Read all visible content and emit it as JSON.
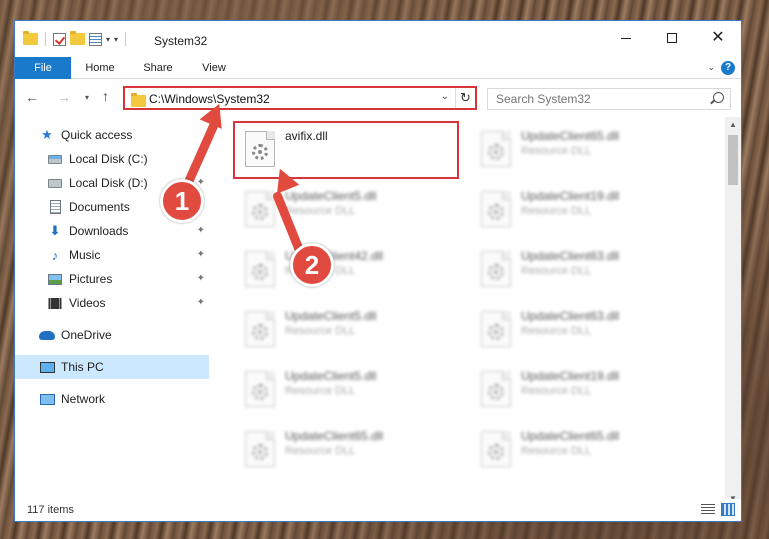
{
  "window": {
    "title": "System32",
    "tabs": [
      "File",
      "Home",
      "Share",
      "View"
    ]
  },
  "address": {
    "path": "C:\\Windows\\System32",
    "search_placeholder": "Search System32"
  },
  "sidebar": {
    "items": [
      {
        "label": "Quick access",
        "icon": "star-icon",
        "pinned": false
      },
      {
        "label": "Local Disk (C:)",
        "icon": "local-disk-c-icon",
        "pinned": false
      },
      {
        "label": "Local Disk (D:)",
        "icon": "local-disk-icon",
        "pinned": true
      },
      {
        "label": "Documents",
        "icon": "documents-icon",
        "pinned": true
      },
      {
        "label": "Downloads",
        "icon": "downloads-icon",
        "pinned": true
      },
      {
        "label": "Music",
        "icon": "music-icon",
        "pinned": true
      },
      {
        "label": "Pictures",
        "icon": "pictures-icon",
        "pinned": true
      },
      {
        "label": "Videos",
        "icon": "videos-icon",
        "pinned": true
      },
      {
        "label": "OneDrive",
        "icon": "onedrive-icon",
        "pinned": false
      },
      {
        "label": "This PC",
        "icon": "this-pc-icon",
        "pinned": false,
        "selected": true
      },
      {
        "label": "Network",
        "icon": "network-icon",
        "pinned": false
      }
    ]
  },
  "files": [
    {
      "name": "avifix.dll",
      "type": "",
      "highlighted": true
    },
    {
      "name": "UpdateClient65.dll",
      "type": "Resource DLL"
    },
    {
      "name": "UpdateClient5.dll",
      "type": "Resource DLL"
    },
    {
      "name": "UpdateClient19.dll",
      "type": "Resource DLL"
    },
    {
      "name": "UpdateClient42.dll",
      "type": "Resource DLL"
    },
    {
      "name": "UpdateClient63.dll",
      "type": "Resource DLL"
    },
    {
      "name": "UpdateClient5.dll",
      "type": "Resource DLL"
    },
    {
      "name": "UpdateClient63.dll",
      "type": "Resource DLL"
    },
    {
      "name": "UpdateClient5.dll",
      "type": "Resource DLL"
    },
    {
      "name": "UpdateClient19.dll",
      "type": "Resource DLL"
    },
    {
      "name": "UpdateClient65.dll",
      "type": "Resource DLL"
    },
    {
      "name": "UpdateClient65.dll",
      "type": "Resource DLL"
    }
  ],
  "status": {
    "item_count": "117 items"
  },
  "annotations": {
    "step1": "1",
    "step2": "2"
  },
  "colors": {
    "accent": "#1979ca",
    "highlight": "#d9343a",
    "annotation": "#e04a3f",
    "selected": "#cce8ff"
  }
}
